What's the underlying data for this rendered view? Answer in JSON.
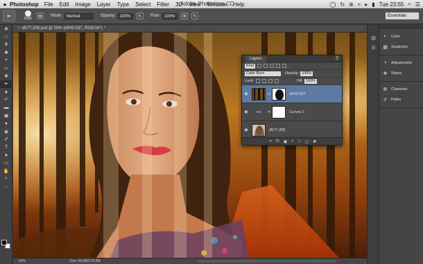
{
  "menubar": {
    "app_name": "Photoshop",
    "items": [
      "File",
      "Edit",
      "Image",
      "Layer",
      "Type",
      "Select",
      "Filter",
      "3D",
      "View",
      "Window",
      "Help"
    ],
    "window_title": "Adobe Photoshop CC",
    "clock": "Tue 23:55"
  },
  "options": {
    "brush_size": "1000",
    "mode_label": "Mode:",
    "mode_value": "Normal",
    "opacity_label": "Opacity:",
    "opacity_value": "100%",
    "flow_label": "Flow:",
    "flow_value": "100%",
    "workspace": "Essentials"
  },
  "document": {
    "tab_title": "d577-209.psd @ 50% (d545-037, RGB/16*) *",
    "zoom": "50%",
    "doc_size": "Doc: 68.8M/179.8M"
  },
  "dock": {
    "groups": [
      [
        {
          "icon": "color-icon",
          "label": "Color"
        },
        {
          "icon": "swatches-icon",
          "label": "Swatches"
        }
      ],
      [
        {
          "icon": "adjustments-icon",
          "label": "Adjustments"
        },
        {
          "icon": "styles-icon",
          "label": "Styles"
        }
      ],
      [
        {
          "icon": "channels-icon",
          "label": "Channels"
        },
        {
          "icon": "paths-icon",
          "label": "Paths"
        }
      ]
    ]
  },
  "layers_panel": {
    "title": "Layers",
    "filter_kind": "Kind",
    "blend_mode": "Color Burn",
    "opacity_label": "Opacity:",
    "opacity_value": "100%",
    "lock_label": "Lock:",
    "fill_label": "Fill:",
    "fill_value": "100%",
    "layers": [
      {
        "name": "d545-037",
        "selected": true
      },
      {
        "name": "Curves 1",
        "selected": false
      },
      {
        "name": "d577-209",
        "selected": false
      }
    ]
  }
}
